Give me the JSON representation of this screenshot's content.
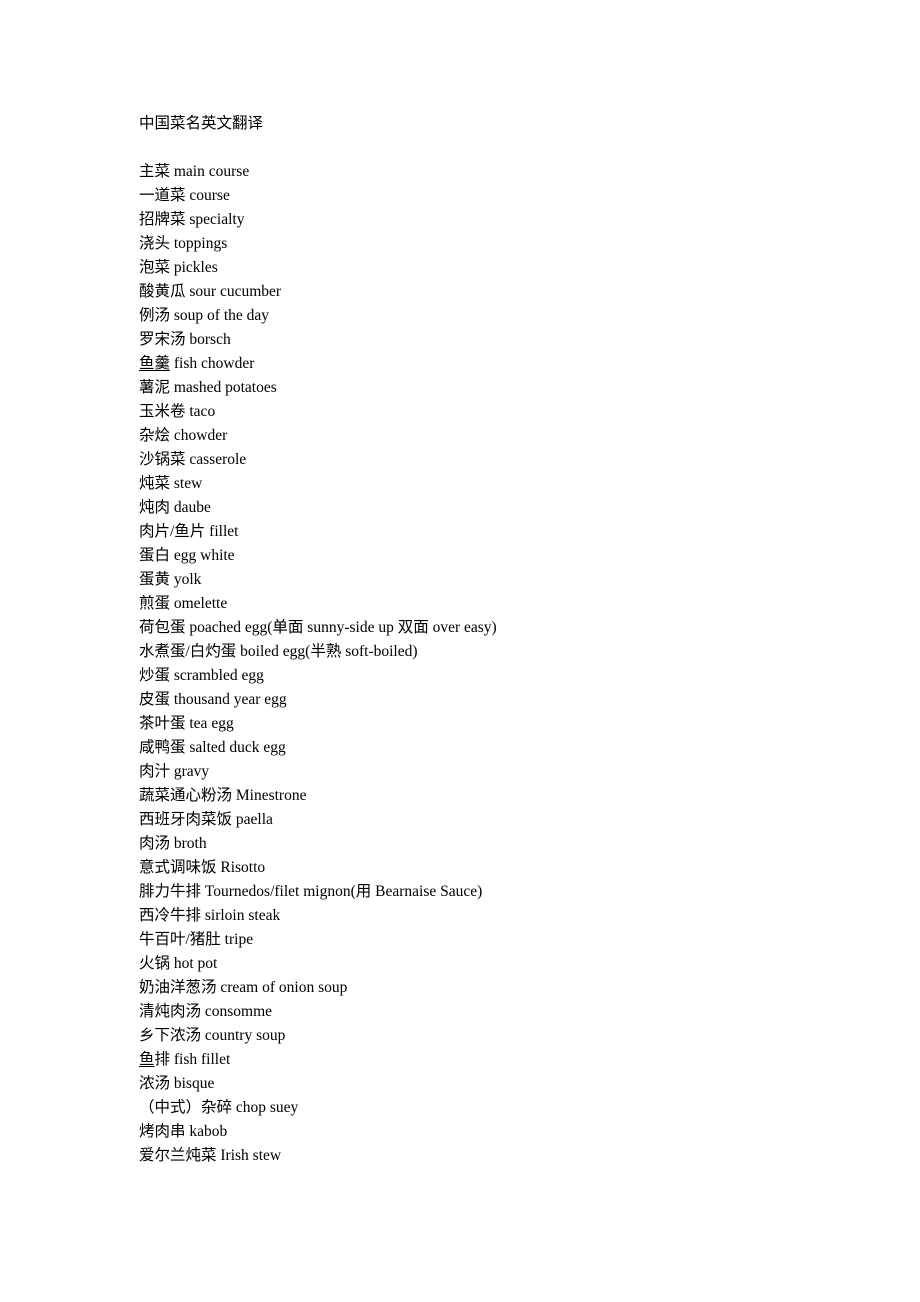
{
  "document": {
    "title": "中国菜名英文翻译",
    "background_color": "#ffffff",
    "text_color": "#000000",
    "entries": [
      {
        "text": "主菜 main course",
        "underlined_prefix": ""
      },
      {
        "text": "一道菜 course",
        "underlined_prefix": ""
      },
      {
        "text": "招牌菜 specialty",
        "underlined_prefix": ""
      },
      {
        "text": "浇头 toppings",
        "underlined_prefix": ""
      },
      {
        "text": "泡菜 pickles",
        "underlined_prefix": ""
      },
      {
        "text": "酸黄瓜 sour cucumber",
        "underlined_prefix": ""
      },
      {
        "text": "例汤 soup of the day",
        "underlined_prefix": ""
      },
      {
        "text": "罗宋汤 borsch",
        "underlined_prefix": ""
      },
      {
        "text": "鱼羹 fish chowder",
        "underlined_prefix": "鱼羹"
      },
      {
        "text": "薯泥 mashed potatoes",
        "underlined_prefix": ""
      },
      {
        "text": "玉米卷 taco",
        "underlined_prefix": ""
      },
      {
        "text": "杂烩 chowder",
        "underlined_prefix": ""
      },
      {
        "text": "沙锅菜 casserole",
        "underlined_prefix": ""
      },
      {
        "text": "炖菜 stew",
        "underlined_prefix": ""
      },
      {
        "text": "炖肉 daube",
        "underlined_prefix": ""
      },
      {
        "text": "肉片/鱼片 fillet",
        "underlined_prefix": ""
      },
      {
        "text": "蛋白 egg white",
        "underlined_prefix": ""
      },
      {
        "text": "蛋黄 yolk",
        "underlined_prefix": ""
      },
      {
        "text": "煎蛋 omelette",
        "underlined_prefix": ""
      },
      {
        "text": "荷包蛋 poached egg(单面 sunny-side up 双面 over easy)",
        "underlined_prefix": ""
      },
      {
        "text": "水煮蛋/白灼蛋 boiled egg(半熟 soft-boiled)",
        "underlined_prefix": ""
      },
      {
        "text": "炒蛋 scrambled egg",
        "underlined_prefix": ""
      },
      {
        "text": "皮蛋 thousand year egg",
        "underlined_prefix": ""
      },
      {
        "text": "茶叶蛋 tea egg",
        "underlined_prefix": ""
      },
      {
        "text": "咸鸭蛋 salted duck egg",
        "underlined_prefix": ""
      },
      {
        "text": "肉汁 gravy",
        "underlined_prefix": ""
      },
      {
        "text": "蔬菜通心粉汤 Minestrone",
        "underlined_prefix": ""
      },
      {
        "text": "西班牙肉菜饭 paella",
        "underlined_prefix": ""
      },
      {
        "text": "肉汤 broth",
        "underlined_prefix": ""
      },
      {
        "text": "意式调味饭 Risotto",
        "underlined_prefix": ""
      },
      {
        "text": "腓力牛排 Tournedos/filet mignon(用 Bearnaise Sauce)",
        "underlined_prefix": ""
      },
      {
        "text": "西冷牛排 sirloin steak",
        "underlined_prefix": ""
      },
      {
        "text": "牛百叶/猪肚 tripe",
        "underlined_prefix": ""
      },
      {
        "text": "火锅 hot pot",
        "underlined_prefix": ""
      },
      {
        "text": "奶油洋葱汤 cream of onion soup",
        "underlined_prefix": ""
      },
      {
        "text": "清炖肉汤 consomme",
        "underlined_prefix": ""
      },
      {
        "text": "乡下浓汤 country soup",
        "underlined_prefix": ""
      },
      {
        "text": "鱼排 fish fillet",
        "underlined_prefix": "鱼"
      },
      {
        "text": "浓汤 bisque",
        "underlined_prefix": ""
      },
      {
        "text": "（中式）杂碎 chop suey",
        "underlined_prefix": ""
      },
      {
        "text": "烤肉串 kabob",
        "underlined_prefix": ""
      },
      {
        "text": "爱尔兰炖菜 Irish stew",
        "underlined_prefix": ""
      }
    ]
  }
}
